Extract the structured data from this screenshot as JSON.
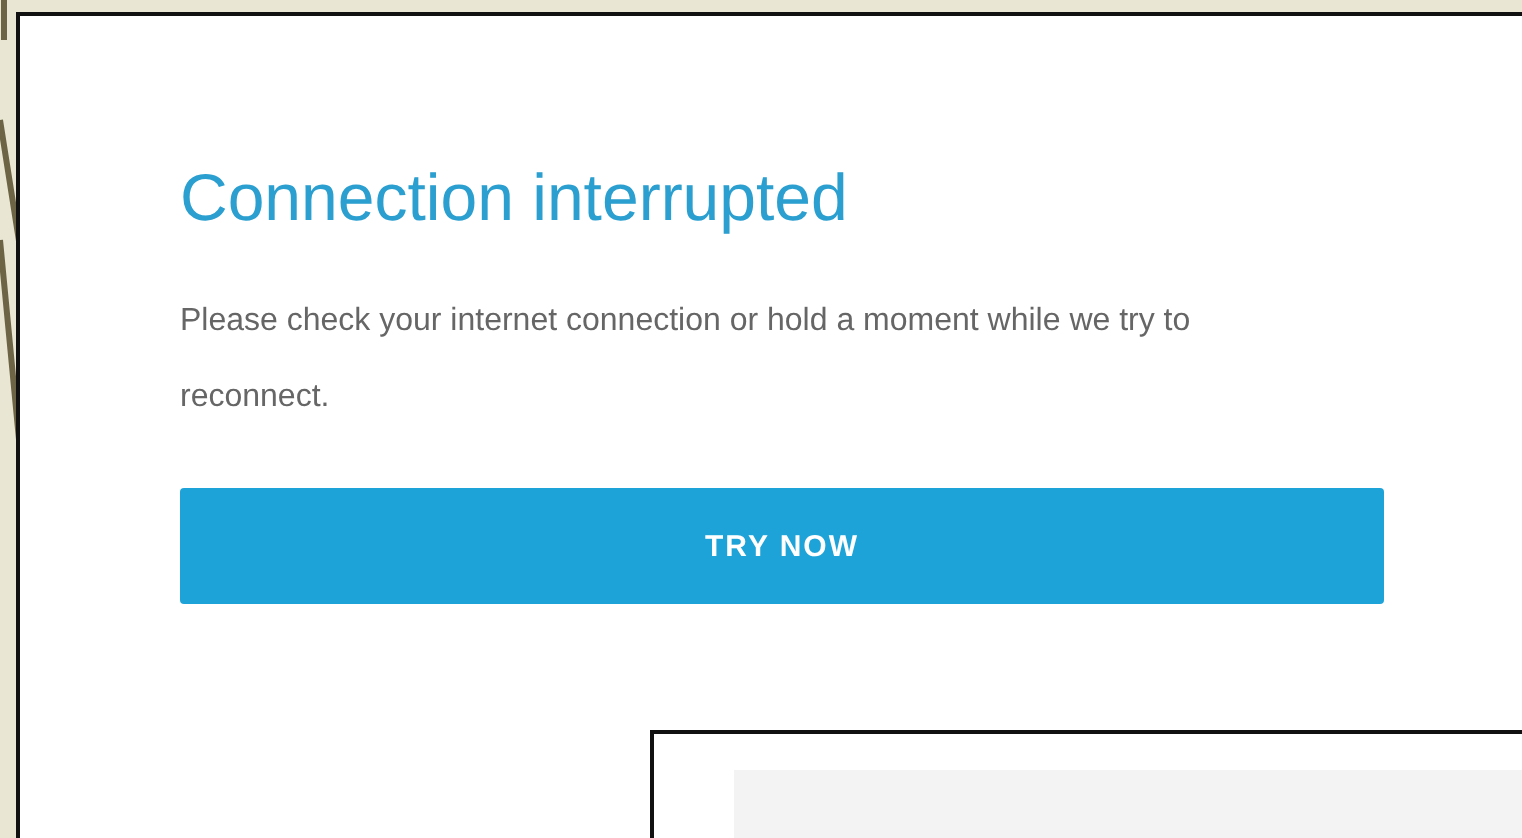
{
  "dialog": {
    "title": "Connection interrupted",
    "message": "Please check your internet connection or hold a moment while we try to reconnect.",
    "button": {
      "label": "TRY NOW"
    }
  }
}
